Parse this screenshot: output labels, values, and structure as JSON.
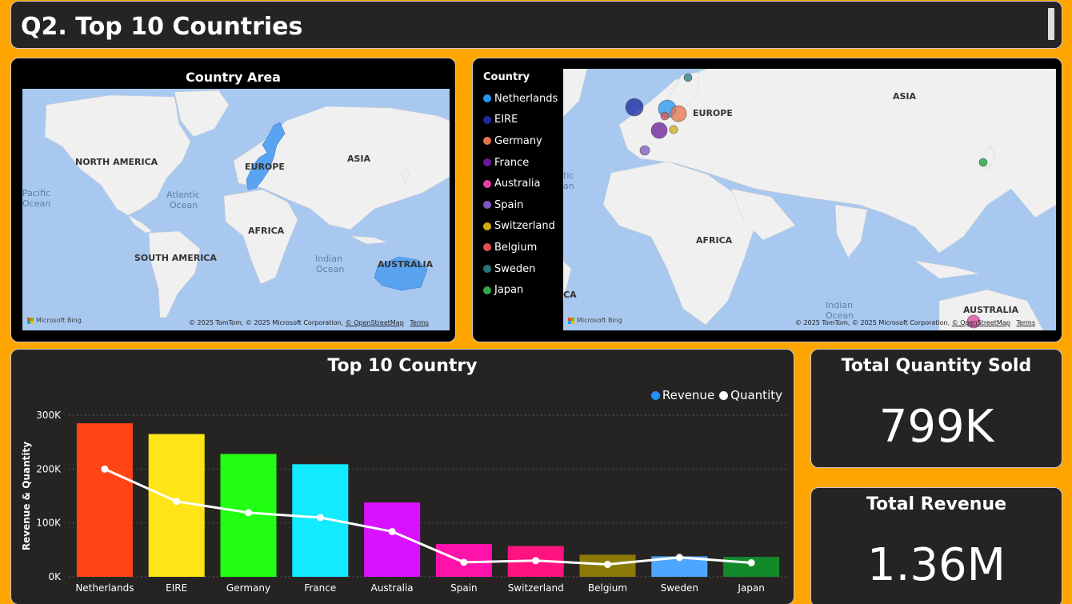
{
  "page": {
    "title": "Q2. Top 10 Countries"
  },
  "map1": {
    "title": "Country Area",
    "labels": {
      "north_america": "NORTH AMERICA",
      "south_america": "SOUTH AMERICA",
      "europe": "EUROPE",
      "asia": "ASIA",
      "africa": "AFRICA",
      "australia": "AUSTRALIA",
      "pacific": "Pacific",
      "pacific2": "Ocean",
      "atlantic": "Atlantic",
      "atlantic2": "Ocean",
      "indian": "Indian",
      "indian2": "Ocean"
    },
    "attribution": "© 2025 TomTom, © 2025 Microsoft Corporation, ",
    "osm_link": "© OpenStreetMap",
    "terms_link": "Terms",
    "bing": "Microsoft Bing",
    "highlight_color": "#5aa3f0"
  },
  "map2": {
    "legend_title": "Country",
    "legend": [
      {
        "name": "Netherlands",
        "color": "#2196F3"
      },
      {
        "name": "EIRE",
        "color": "#1a2aa0"
      },
      {
        "name": "Germany",
        "color": "#E8734A"
      },
      {
        "name": "France",
        "color": "#6a1b9a"
      },
      {
        "name": "Australia",
        "color": "#E040A0"
      },
      {
        "name": "Spain",
        "color": "#7e57c2"
      },
      {
        "name": "Switzerland",
        "color": "#D4AC0D"
      },
      {
        "name": "Belgium",
        "color": "#E05050"
      },
      {
        "name": "Sweden",
        "color": "#26787a"
      },
      {
        "name": "Japan",
        "color": "#2ea84a"
      }
    ],
    "labels": {
      "europe": "EUROPE",
      "asia": "ASIA",
      "africa": "AFRICA",
      "australia": "AUSTRALIA",
      "indian": "Indian",
      "indian2": "Ocean",
      "tic": "tic",
      "an": "an",
      "ca": "CA"
    },
    "attribution": "© 2025 TomTom, © 2025 Microsoft Corporation, ",
    "osm_link": "© OpenStreetMap",
    "terms_link": "Terms",
    "bing": "Microsoft Bing"
  },
  "chart": {
    "title": "Top 10 Country",
    "legend_revenue": "Revenue",
    "legend_quantity": "Quantity",
    "revenue_color": "#1E90FF",
    "quantity_color": "#FFFFFF",
    "ylabel": "Revenue & Quantity",
    "yticks": [
      "0K",
      "100K",
      "200K",
      "300K"
    ]
  },
  "chart_data": {
    "type": "bar",
    "title": "Top 10 Country",
    "categories": [
      "Netherlands",
      "EIRE",
      "Germany",
      "France",
      "Australia",
      "Spain",
      "Switzerland",
      "Belgium",
      "Sweden",
      "Japan"
    ],
    "series": [
      {
        "name": "Revenue",
        "type": "bar",
        "values": [
          285000,
          265000,
          228000,
          209000,
          138000,
          61000,
          57000,
          41000,
          38000,
          37000
        ]
      },
      {
        "name": "Quantity",
        "type": "line",
        "values": [
          200000,
          140000,
          119000,
          110000,
          84000,
          27000,
          30000,
          23000,
          36000,
          26000
        ]
      }
    ],
    "bar_colors": [
      "#FF4515",
      "#FFE517",
      "#22FF12",
      "#12EAFF",
      "#D812FF",
      "#FF12AA",
      "#FF1380",
      "#8C7A08",
      "#4DA6FF",
      "#138A2A"
    ],
    "ylabel": "Revenue & Quantity",
    "xlabel": "",
    "ylim": [
      0,
      300000
    ],
    "grid": true,
    "legend_position": "top-right"
  },
  "kpis": {
    "quantity_title": "Total Quantity Sold",
    "quantity_value": "799K",
    "revenue_title": "Total Revenue",
    "revenue_value": "1.36M"
  }
}
